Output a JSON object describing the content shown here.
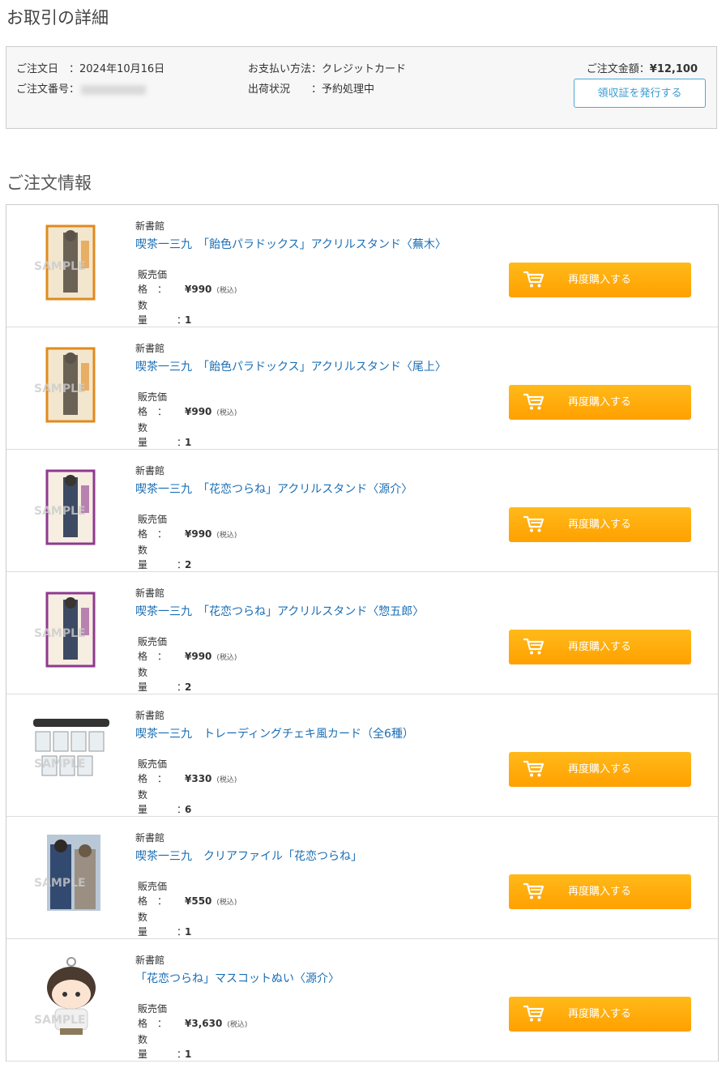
{
  "page": {
    "title": "お取引の詳細",
    "section_title": "ご注文情報"
  },
  "summary": {
    "order_date_label": "ご注文日　：",
    "order_date": "2024年10月16日",
    "order_number_label": "ご注文番号：",
    "payment_label": "お支払い方法：",
    "payment": "クレジットカード",
    "shipping_label": "出荷状況　　：",
    "shipping": "予約処理中",
    "total_label": "ご注文金額：",
    "total": "¥12,100",
    "receipt_button": "領収証を発行する"
  },
  "labels": {
    "price": "販売価格　：",
    "qty": "数量　　　：",
    "tax": "(税込)",
    "rebuy": "再度購入する"
  },
  "colors": {
    "link": "#1a6eb5",
    "button": "#ffa800",
    "receipt_border": "#4aa8d8"
  },
  "items": [
    {
      "publisher": "新書館",
      "title": "喫茶一三九　「飴色パラドックス」アクリルスタンド〈蕪木〉",
      "price": "¥990",
      "qty": "1",
      "thumb": "acrylic-orange"
    },
    {
      "publisher": "新書館",
      "title": "喫茶一三九　「飴色パラドックス」アクリルスタンド〈尾上〉",
      "price": "¥990",
      "qty": "1",
      "thumb": "acrylic-orange"
    },
    {
      "publisher": "新書館",
      "title": "喫茶一三九　「花恋つらね」アクリルスタンド〈源介〉",
      "price": "¥990",
      "qty": "2",
      "thumb": "acrylic-purple"
    },
    {
      "publisher": "新書館",
      "title": "喫茶一三九　「花恋つらね」アクリルスタンド〈惣五郎〉",
      "price": "¥990",
      "qty": "2",
      "thumb": "acrylic-purple"
    },
    {
      "publisher": "新書館",
      "title": "喫茶一三九　トレーディングチェキ風カード（全6種）",
      "price": "¥330",
      "qty": "6",
      "thumb": "cards"
    },
    {
      "publisher": "新書館",
      "title": "喫茶一三九　クリアファイル「花恋つらね」",
      "price": "¥550",
      "qty": "1",
      "thumb": "file"
    },
    {
      "publisher": "新書館",
      "title": "「花恋つらね」マスコットぬい〈源介〉",
      "price": "¥3,630",
      "qty": "1",
      "thumb": "plush"
    }
  ]
}
